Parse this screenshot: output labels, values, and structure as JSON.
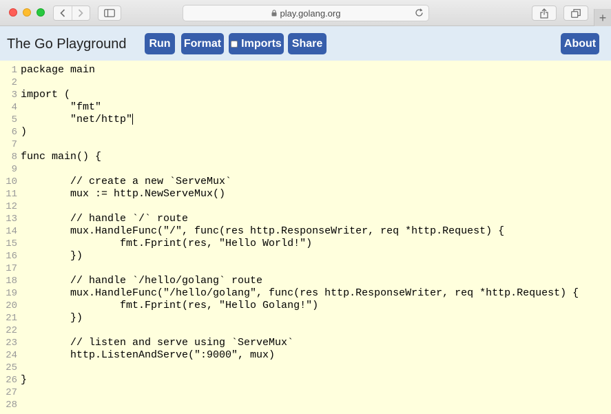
{
  "browser": {
    "url": "play.golang.org",
    "new_tab_label": "+"
  },
  "header": {
    "title": "The Go Playground",
    "buttons": {
      "run": "Run",
      "format": "Format",
      "imports": "Imports",
      "share": "Share",
      "about": "About"
    },
    "imports_checked": false
  },
  "editor": {
    "cursor_line": 5,
    "lines": [
      {
        "n": "1",
        "text": "package main"
      },
      {
        "n": "2",
        "text": ""
      },
      {
        "n": "3",
        "text": "import ("
      },
      {
        "n": "4",
        "text": "        \"fmt\""
      },
      {
        "n": "5",
        "text": "        \"net/http\""
      },
      {
        "n": "6",
        "text": ")"
      },
      {
        "n": "7",
        "text": ""
      },
      {
        "n": "8",
        "text": "func main() {"
      },
      {
        "n": "9",
        "text": ""
      },
      {
        "n": "10",
        "text": "        // create a new `ServeMux`"
      },
      {
        "n": "11",
        "text": "        mux := http.NewServeMux()"
      },
      {
        "n": "12",
        "text": ""
      },
      {
        "n": "13",
        "text": "        // handle `/` route"
      },
      {
        "n": "14",
        "text": "        mux.HandleFunc(\"/\", func(res http.ResponseWriter, req *http.Request) {"
      },
      {
        "n": "15",
        "text": "                fmt.Fprint(res, \"Hello World!\")"
      },
      {
        "n": "16",
        "text": "        })"
      },
      {
        "n": "17",
        "text": ""
      },
      {
        "n": "18",
        "text": "        // handle `/hello/golang` route"
      },
      {
        "n": "19",
        "text": "        mux.HandleFunc(\"/hello/golang\", func(res http.ResponseWriter, req *http.Request) {"
      },
      {
        "n": "20",
        "text": "                fmt.Fprint(res, \"Hello Golang!\")"
      },
      {
        "n": "21",
        "text": "        })"
      },
      {
        "n": "22",
        "text": ""
      },
      {
        "n": "23",
        "text": "        // listen and serve using `ServeMux`"
      },
      {
        "n": "24",
        "text": "        http.ListenAndServe(\":9000\", mux)"
      },
      {
        "n": "25",
        "text": ""
      },
      {
        "n": "26",
        "text": "}"
      },
      {
        "n": "27",
        "text": ""
      },
      {
        "n": "28",
        "text": ""
      }
    ]
  }
}
